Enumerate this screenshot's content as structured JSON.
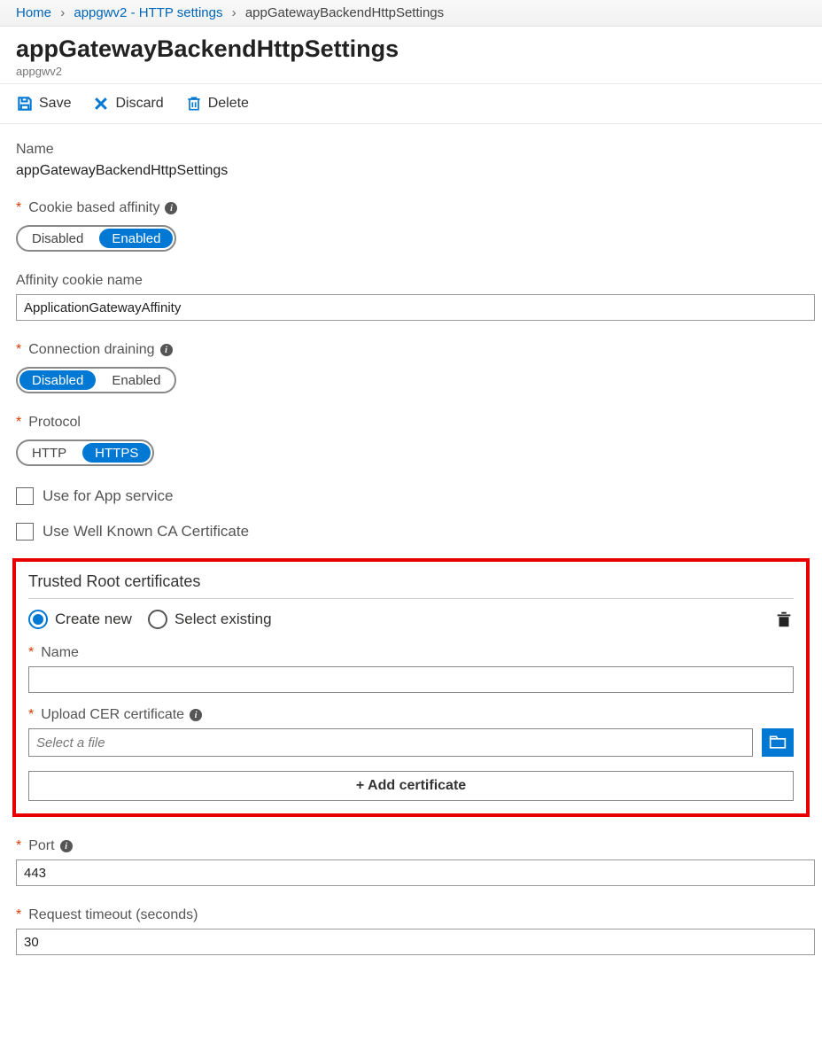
{
  "breadcrumb": {
    "home": "Home",
    "level1": "appgwv2 - HTTP settings",
    "current": "appGatewayBackendHttpSettings"
  },
  "header": {
    "title": "appGatewayBackendHttpSettings",
    "subtitle": "appgwv2"
  },
  "toolbar": {
    "save": "Save",
    "discard": "Discard",
    "delete": "Delete"
  },
  "fields": {
    "name_label": "Name",
    "name_value": "appGatewayBackendHttpSettings",
    "cookie_affinity_label": "Cookie based affinity",
    "cookie_affinity_options": {
      "disabled": "Disabled",
      "enabled": "Enabled"
    },
    "affinity_cookie_name_label": "Affinity cookie name",
    "affinity_cookie_name_value": "ApplicationGatewayAffinity",
    "connection_draining_label": "Connection draining",
    "connection_draining_options": {
      "disabled": "Disabled",
      "enabled": "Enabled"
    },
    "protocol_label": "Protocol",
    "protocol_options": {
      "http": "HTTP",
      "https": "HTTPS"
    },
    "use_app_service_label": "Use for App service",
    "use_well_known_ca_label": "Use Well Known CA Certificate",
    "port_label": "Port",
    "port_value": "443",
    "request_timeout_label": "Request timeout (seconds)",
    "request_timeout_value": "30"
  },
  "trusted_root": {
    "title": "Trusted Root certificates",
    "create_new": "Create new",
    "select_existing": "Select existing",
    "name_label": "Name",
    "upload_label": "Upload CER certificate",
    "file_placeholder": "Select a file",
    "add_certificate": "+ Add certificate"
  }
}
